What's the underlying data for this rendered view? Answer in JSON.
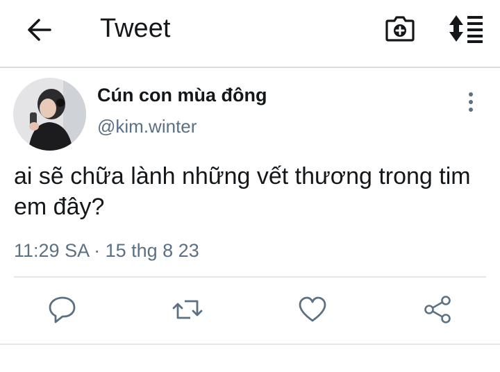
{
  "header": {
    "title": "Tweet",
    "back_icon": "arrow-left-icon",
    "camera_icon": "camera-plus-icon",
    "sort_icon": "sort-list-icon"
  },
  "tweet": {
    "display_name": "Cún con mùa đông",
    "handle": "@kim.winter",
    "text": "ai sẽ chữa lành những vết thương trong tim em đây?",
    "timestamp": "11:29 SA · 15 thg 8 23"
  },
  "actions": [
    {
      "icon": "reply-icon"
    },
    {
      "icon": "retweet-icon"
    },
    {
      "icon": "like-icon"
    },
    {
      "icon": "share-icon"
    }
  ],
  "colors": {
    "primary_text": "#14171a",
    "secondary_text": "#5b7083",
    "divider": "#e1e6ea"
  }
}
